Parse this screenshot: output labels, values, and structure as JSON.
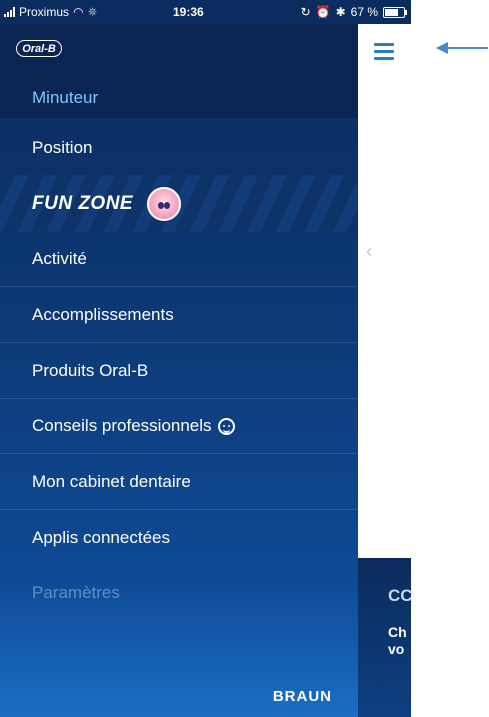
{
  "status_bar": {
    "carrier": "Proximus",
    "time": "19:36",
    "battery": "67 %",
    "battery_level": 0.67
  },
  "drawer": {
    "logo": "Oral-B",
    "items": [
      {
        "label": "Minuteur",
        "state": "active"
      },
      {
        "label": "Position"
      },
      {
        "label": "Activité"
      },
      {
        "label": "Accomplissements"
      },
      {
        "label": "Produits Oral-B"
      },
      {
        "label": "Conseils professionnels"
      },
      {
        "label": "Mon cabinet dentaire"
      },
      {
        "label": "Applis connectées"
      },
      {
        "label": "Paramètres",
        "state": "disabled"
      }
    ],
    "fun_zone": "FUN ZONE",
    "brand": "BRAUN"
  },
  "content": {
    "title_fragment": "CC",
    "text_line1": "Ch",
    "text_line2": "vo"
  },
  "colors": {
    "drawer_bg": "#0b2b5c",
    "active_item": "#7fc6ff",
    "accent": "#2b7bd0"
  }
}
